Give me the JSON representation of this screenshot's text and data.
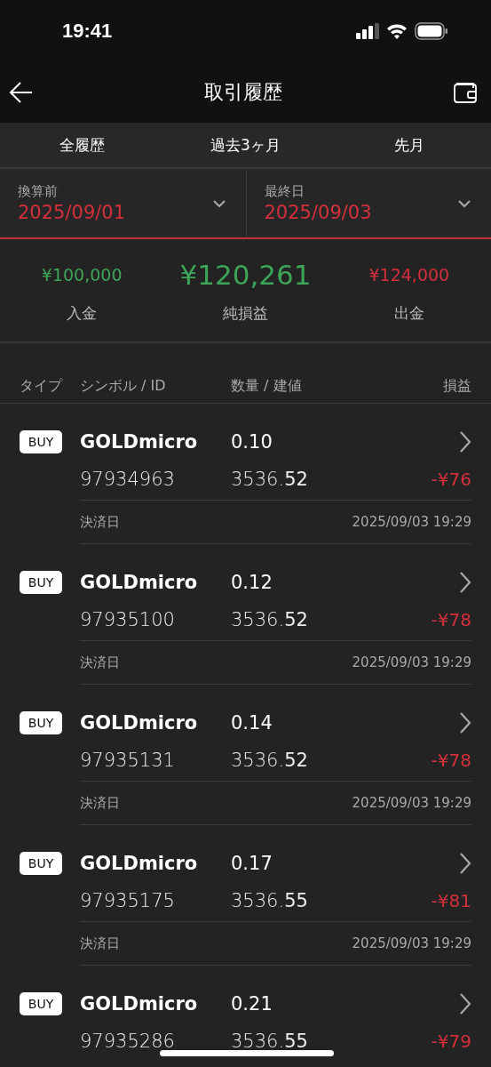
{
  "status_bar": {
    "time": "19:41"
  },
  "nav": {
    "title": "取引履歴"
  },
  "tabs": [
    {
      "label": "全履歴"
    },
    {
      "label": "過去3ヶ月"
    },
    {
      "label": "先月"
    }
  ],
  "date_pickers": [
    {
      "label": "換算前",
      "value": "2025/09/01"
    },
    {
      "label": "最終日",
      "value": "2025/09/03"
    }
  ],
  "summary": [
    {
      "value": "¥100,000",
      "label": "入金",
      "color": "#3ea457",
      "emphasis": false
    },
    {
      "value": "¥120,261",
      "label": "純損益",
      "color": "#3ea457",
      "emphasis": true
    },
    {
      "value": "¥124,000",
      "label": "出金",
      "color": "#d3303c",
      "emphasis": false
    }
  ],
  "table": {
    "columns": [
      "タイプ",
      "シンボル / ID",
      "数量 / 建値",
      "損益"
    ],
    "rows": [
      {
        "type": "BUY",
        "symbol": "GOLDmicro",
        "id": "97934963",
        "volume": "0.10",
        "price": "3536.**52**",
        "profit": "-¥76",
        "color": "#d3303c",
        "settle_label": "決済日",
        "settle_time": "2025/09/03 19:29"
      },
      {
        "type": "BUY",
        "symbol": "GOLDmicro",
        "id": "97935100",
        "volume": "0.12",
        "price": "3536.**52**",
        "profit": "-¥78",
        "color": "#d3303c",
        "settle_label": "決済日",
        "settle_time": "2025/09/03 19:29"
      },
      {
        "type": "BUY",
        "symbol": "GOLDmicro",
        "id": "97935131",
        "volume": "0.14",
        "price": "3536.**52**",
        "profit": "-¥78",
        "color": "#d3303c",
        "settle_label": "決済日",
        "settle_time": "2025/09/03 19:29"
      },
      {
        "type": "BUY",
        "symbol": "GOLDmicro",
        "id": "97935175",
        "volume": "0.17",
        "price": "3536.**55**",
        "profit": "-¥81",
        "color": "#d3303c",
        "settle_label": "決済日",
        "settle_time": "2025/09/03 19:29"
      },
      {
        "type": "BUY",
        "symbol": "GOLDmicro",
        "id": "97935286",
        "volume": "0.21",
        "price": "3536.**55**",
        "profit": "-¥79",
        "color": "#d3303c"
      }
    ]
  }
}
